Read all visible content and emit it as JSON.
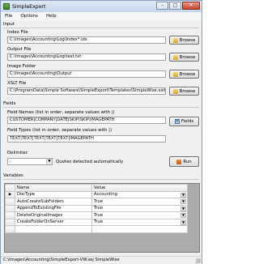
{
  "window": {
    "title": "SimpleExport",
    "minimize": "–",
    "maximize": "□",
    "close": "✕"
  },
  "menu": [
    "File",
    "Options",
    "Help"
  ],
  "input": {
    "section": "Input",
    "index_file": {
      "label": "Index File",
      "value": "C:\\Images\\Accounting\\Log\\Index*.idx"
    },
    "output_file": {
      "label": "Output File",
      "value": "C:\\Images\\Accounting\\Log\\test.txt"
    },
    "image_folder": {
      "label": "Image Folder",
      "value": "C:\\Images\\Accounting\\Output"
    },
    "xslt_file": {
      "label": "XSLT File",
      "value": "C:\\ProgramData\\Simple Software\\SimpleExport\\Templates\\SimpleWise.xslt"
    },
    "browse_label": "Browse"
  },
  "fields": {
    "section": "Fields",
    "names_label": "Field Names (list in order, separate values with |)",
    "names_value": "CUSTOMER|COMPANY|DATE|SKIP|SKIP|IMAGEPATH",
    "types_label": "Field Types (list in order, separate values with |)",
    "types_value": "TEXT|TEXT|TEXT|TEXT|TEXT|IMAGEPATH",
    "fields_button": "Fields"
  },
  "delimiter": {
    "label": "Delimiter",
    "value": ",",
    "quotes_note": "Quotes detected automatically",
    "run_button": "Run"
  },
  "variables": {
    "section": "Variables",
    "columns": [
      "Name",
      "Value"
    ],
    "current_marker": "▶",
    "rows": [
      {
        "name": "DocType",
        "value": "Accounting"
      },
      {
        "name": "AutoCreateSubFolders",
        "value": "True"
      },
      {
        "name": "AppendToExistingFile",
        "value": "True"
      },
      {
        "name": "DeleteOriginalImages",
        "value": "True"
      },
      {
        "name": "CreateFolderOnServer",
        "value": "True"
      }
    ],
    "new_row": {
      "name": "",
      "value": ""
    }
  },
  "status": {
    "text": "C:\\Images\\Accounting\\SimpleExport-VW.sej   SimpleWise"
  }
}
